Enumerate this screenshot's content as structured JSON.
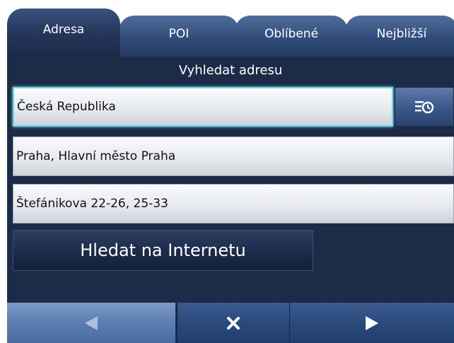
{
  "tabs": [
    {
      "label": "Adresa",
      "active": true
    },
    {
      "label": "POI",
      "active": false
    },
    {
      "label": "Oblíbené",
      "active": false
    },
    {
      "label": "Nejbližší",
      "active": false
    }
  ],
  "heading": "Vyhledat adresu",
  "fields": {
    "country": "Česká Republika",
    "city": "Praha, Hlavní město Praha",
    "street": "Štefánikova 22-26, 25-33"
  },
  "history_icon": "history-clock-icon",
  "search_button": "Hledat na Internetu",
  "toolbar": {
    "back_icon": "back-arrow-icon",
    "close_icon": "close-icon",
    "next_icon": "next-arrow-icon"
  },
  "colors": {
    "background": "#1c2b47",
    "tab": "#2f4a78",
    "focus": "#6fd9e8",
    "back_button": "#5b7db0"
  }
}
